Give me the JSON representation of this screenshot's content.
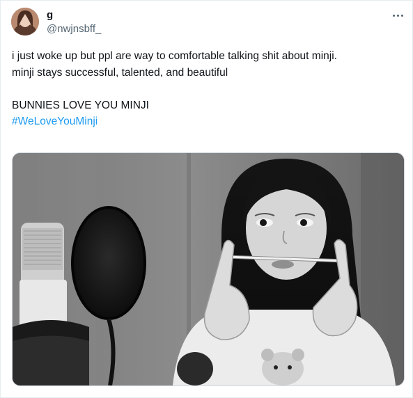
{
  "tweet": {
    "author": {
      "display_name": "g",
      "handle": "@nwjnsbff_"
    },
    "more_options_icon": "more-horizontal-icon",
    "text_lines": [
      "i just woke up but ppl are way to comfortable talking shit about minji.",
      "minji stays successful, talented, and beautiful"
    ],
    "text_line_2": "BUNNIES LOVE YOU MINJI",
    "hashtag": "#WeLoveYouMinji",
    "media": {
      "kind": "black-and-white photo"
    }
  },
  "colors": {
    "text": "#0f1419",
    "secondary_text": "#536471",
    "link": "#1d9bf0",
    "border": "#cfd9de"
  }
}
